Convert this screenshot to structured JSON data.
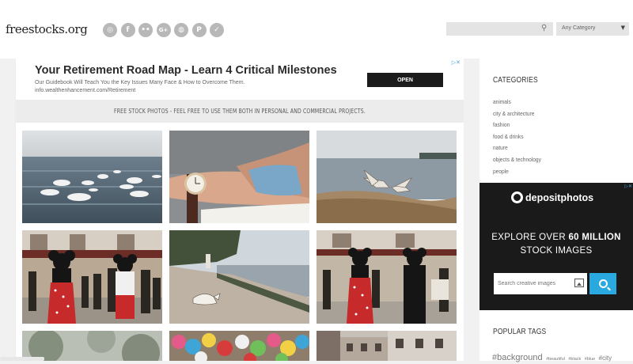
{
  "header": {
    "logo": "freestocks.org",
    "social_icons": [
      {
        "name": "instagram-icon",
        "glyph": "◎"
      },
      {
        "name": "facebook-icon",
        "glyph": "f"
      },
      {
        "name": "flickr-icon",
        "glyph": "••"
      },
      {
        "name": "google-plus-icon",
        "glyph": "G+"
      },
      {
        "name": "dribbble-icon",
        "glyph": "◍"
      },
      {
        "name": "pinterest-icon",
        "glyph": "P"
      },
      {
        "name": "twitter-icon",
        "glyph": "✓"
      }
    ],
    "search_placeholder": "",
    "category_select": "Any Category"
  },
  "ad": {
    "title": "Your Retirement Road Map - Learn 4 Critical Milestones",
    "subtitle": "Our Guidebook Will Teach You the Key Issues Many Face & How to Overcome Them.",
    "url": "info.wealthenhancement.com/Retirement",
    "button": "OPEN"
  },
  "tagline": "FREE STOCK PHOTOS - FEEL FREE TO USE THEM BOTH IN PERSONAL AND COMMERCIAL PROJECTS.",
  "photos": [
    {
      "name": "photo-swans-on-lake"
    },
    {
      "name": "photo-wrist-watch"
    },
    {
      "name": "photo-seagull-on-shore"
    },
    {
      "name": "photo-minnie-mouse-crowd"
    },
    {
      "name": "photo-seagull-on-beach"
    },
    {
      "name": "photo-minnie-mouse-street"
    },
    {
      "name": "photo-blurred-foliage"
    },
    {
      "name": "photo-plush-toys"
    },
    {
      "name": "photo-city-building"
    }
  ],
  "sidebar": {
    "categories_title": "CATEGORIES",
    "categories": [
      "animals",
      "city & architecture",
      "fashion",
      "food & drinks",
      "nature",
      "objects & technology",
      "people"
    ],
    "depositphotos": {
      "brand": "depositphotos",
      "line1_pre": "EXPLORE OVER ",
      "line1_bold": "60 MILLION",
      "line2": "STOCK IMAGES",
      "search_placeholder": "Search creative images"
    },
    "tags_title": "POPULAR TAGS",
    "tags": [
      "#background",
      "#beautiful",
      "#black",
      "#blue",
      "#city"
    ]
  },
  "colors": {
    "page_bg": "#f1f1f1",
    "accent_blue": "#2aa9e0",
    "ad_button": "#1b1b1b"
  }
}
